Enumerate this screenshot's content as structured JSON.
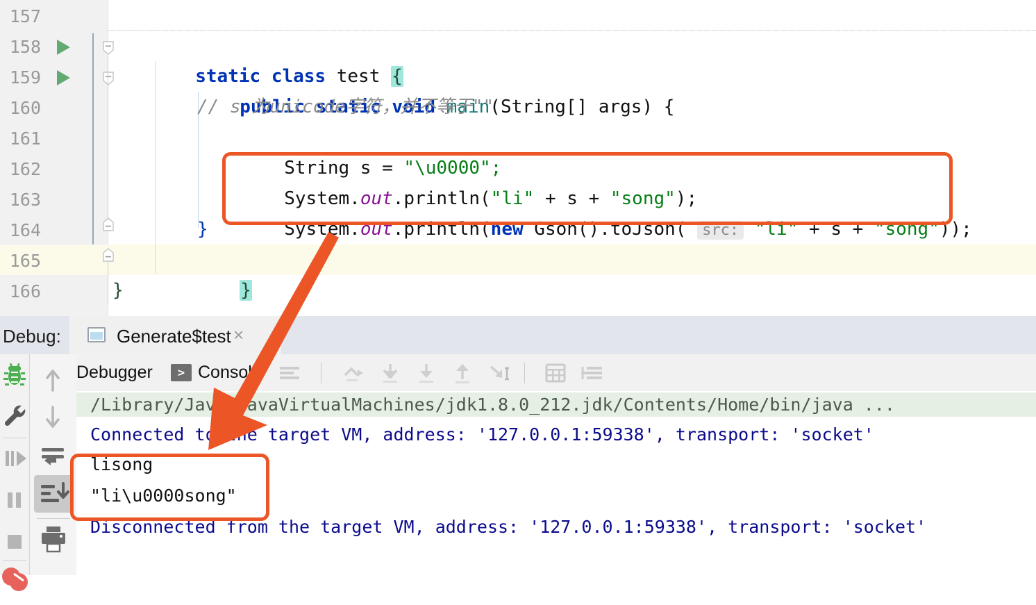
{
  "editor": {
    "lines": [
      {
        "num": "157",
        "run_marker": false,
        "fold": false,
        "text": ""
      },
      {
        "num": "158",
        "run_marker": true,
        "fold": true,
        "text": "    static class test {"
      },
      {
        "num": "159",
        "run_marker": true,
        "fold": true,
        "text": "        public static void main(String[] args) {"
      },
      {
        "num": "160",
        "run_marker": false,
        "fold": false,
        "text": "            // s 为unicode字符，并不等于\"\""
      },
      {
        "num": "161",
        "run_marker": false,
        "fold": false,
        "text": "            String s = \"\\u0000\";"
      },
      {
        "num": "162",
        "run_marker": false,
        "fold": false,
        "text": "            System.out.println(\"li\" + s + \"song\");"
      },
      {
        "num": "163",
        "run_marker": false,
        "fold": false,
        "text": "            System.out.println(new Gson().toJson( src: \"li\" + s + \"song\"));"
      },
      {
        "num": "164",
        "run_marker": false,
        "fold": true,
        "text": "        }"
      },
      {
        "num": "165",
        "run_marker": false,
        "fold": true,
        "text": "    }"
      },
      {
        "num": "166",
        "run_marker": false,
        "fold": false,
        "text": "}"
      }
    ],
    "tokens": {
      "static": "static",
      "class": "class",
      "test": "test",
      "brace_open": "{",
      "public": "public",
      "void": "void",
      "main": "main",
      "String": "String",
      "args_sig": "(String[] args) {",
      "comment": "// s 为unicode字符，并不等于\"\"",
      "string_decl": "String s = ",
      "u0000": "\"\\u0000\";",
      "sysout": "System.",
      "out": "out",
      "println": ".println(",
      "li": "\"li\"",
      "plus_s_plus": " + s + ",
      "song": "\"song\"",
      "end_1": ");",
      "new": "new",
      "gson": " Gson().toJson( ",
      "src_hint": "src:",
      "end_2": "));",
      "close_brace": "}",
      "current_line_number": "165"
    },
    "current_line": "165"
  },
  "debug": {
    "label": "Debug:",
    "tab_title": "Generate$test",
    "close_glyph": "×",
    "side_rail": [
      {
        "name": "debug-bug-icon",
        "glyph": "bug"
      },
      {
        "name": "settings-wrench-icon",
        "glyph": "wrench"
      },
      {
        "name": "resume-program-icon",
        "glyph": "resume"
      },
      {
        "name": "pause-program-icon",
        "glyph": "pause"
      },
      {
        "name": "stop-program-icon",
        "glyph": "stop"
      },
      {
        "name": "view-breakpoints-icon",
        "glyph": "breakpoints"
      }
    ],
    "tool_rail": [
      {
        "name": "up-arrow-icon",
        "glyph": "↑"
      },
      {
        "name": "down-arrow-icon",
        "glyph": "↓"
      },
      {
        "name": "soft-wrap-icon",
        "glyph": "wrap"
      },
      {
        "name": "scroll-to-end-icon",
        "glyph": "scroll-end",
        "active": true
      },
      {
        "name": "print-icon",
        "glyph": "print"
      }
    ],
    "tabs": [
      {
        "label": "Debugger",
        "selected": false
      },
      {
        "label": "Console",
        "selected": true,
        "icon": ">"
      }
    ],
    "toolbar_icons": [
      "layout-settings-icon",
      "step-over-icon",
      "step-into-icon",
      "force-step-into-icon",
      "step-out-icon",
      "run-to-cursor-icon",
      "evaluate-expression-icon",
      "sort-icon"
    ]
  },
  "console": {
    "lines": [
      {
        "text": "/Library/Java/JavaVirtualMachines/jdk1.8.0_212.jdk/Contents/Home/bin/java ...",
        "type": "command"
      },
      {
        "text": "Connected to the target VM, address: '127.0.0.1:59338', transport: 'socket'",
        "type": "system"
      },
      {
        "text": "lisong",
        "type": "stdout"
      },
      {
        "text": "\"li\\u0000song\"",
        "type": "stdout"
      },
      {
        "text": "Disconnected from the target VM, address: '127.0.0.1:59338', transport: 'socket'",
        "type": "system"
      }
    ]
  },
  "annotations": {
    "accent_color": "#ec5526",
    "code_highlight_box": "lines 162-163 System.out.println calls",
    "output_highlight_box": "console output lisong and \"li\\u0000song\"",
    "arrow": "points from code highlight down to console output"
  },
  "colors": {
    "keyword": "#0033b3",
    "string": "#067d17",
    "field": "#871094",
    "comment": "#8c8c8c",
    "console_system": "#0b0b8c",
    "command_bg": "#e6efe4",
    "current_line_bg": "#fcfae8",
    "brace_match_bg": "#9fe6dd",
    "tab_underline": "#3d7bbf",
    "run_marker": "#4a9d5b"
  }
}
